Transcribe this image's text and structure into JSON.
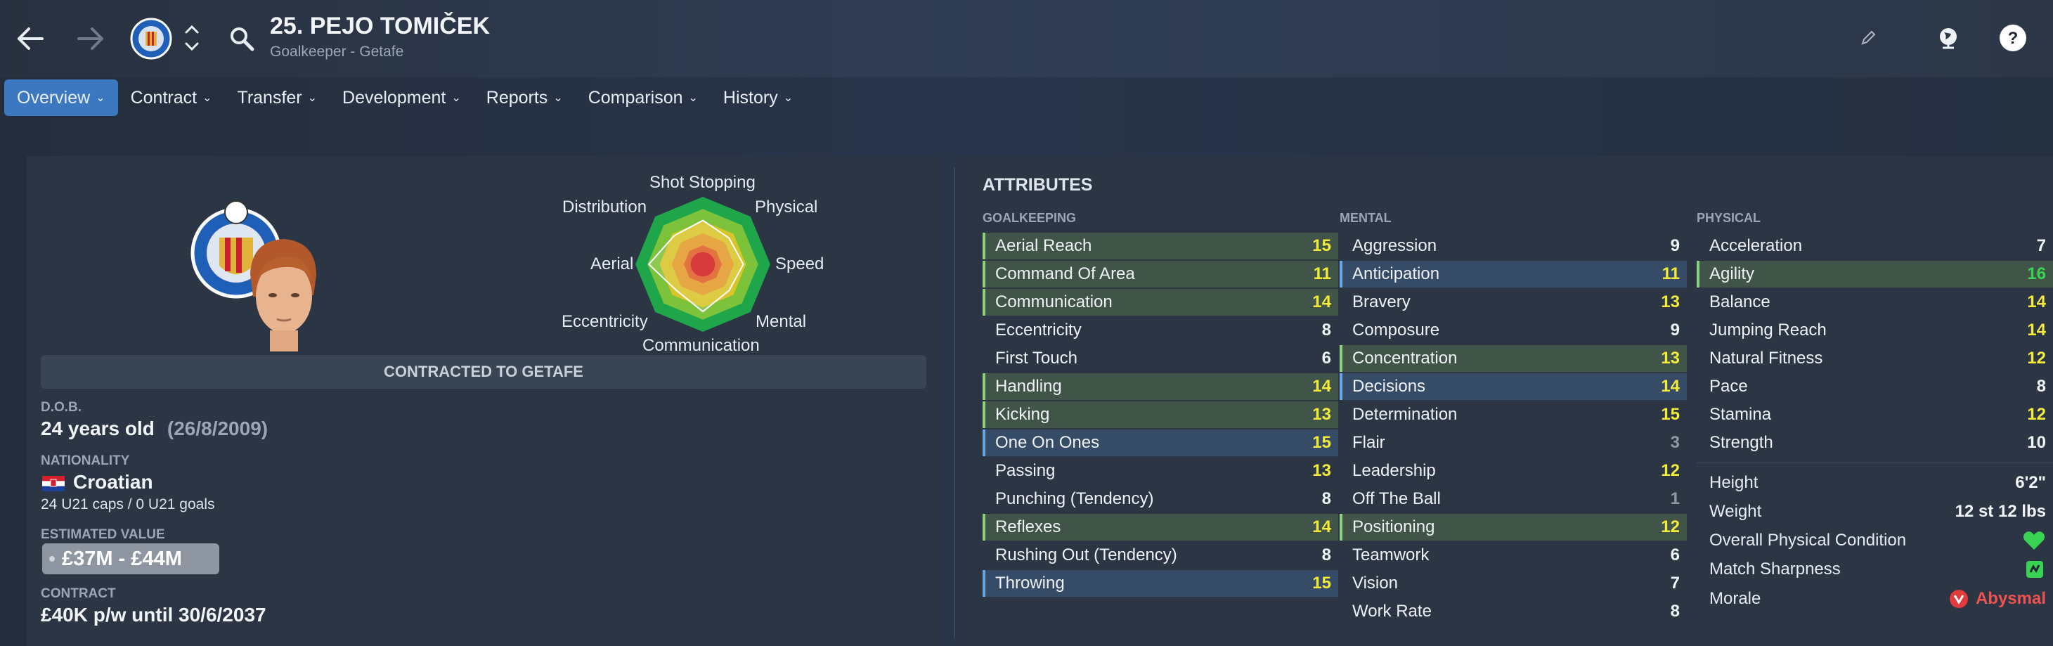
{
  "header": {
    "player_name": "25. PEJO TOMIČEK",
    "subtitle": "Goalkeeper - Getafe"
  },
  "tabs": [
    {
      "label": "Overview",
      "active": true
    },
    {
      "label": "Contract"
    },
    {
      "label": "Transfer"
    },
    {
      "label": "Development"
    },
    {
      "label": "Reports"
    },
    {
      "label": "Comparison"
    },
    {
      "label": "History"
    }
  ],
  "radar": {
    "labels": [
      "Shot Stopping",
      "Physical",
      "Speed",
      "Mental",
      "Communication",
      "Eccentricity",
      "Aerial",
      "Distribution"
    ],
    "values": [
      0.65,
      0.55,
      0.6,
      0.55,
      0.7,
      0.55,
      0.8,
      0.6
    ]
  },
  "profile": {
    "contracted_to": "CONTRACTED TO GETAFE",
    "dob_label": "D.O.B.",
    "age": "24 years old",
    "dob": "(26/8/2009)",
    "nationality_label": "NATIONALITY",
    "nationality": "Croatian",
    "caps": "24 U21 caps / 0 U21 goals",
    "value_label": "ESTIMATED VALUE",
    "value": "£37M - £44M",
    "contract_label": "CONTRACT",
    "contract": "£40K p/w until 30/6/2037"
  },
  "attributes": {
    "title": "ATTRIBUTES",
    "goalkeeping": {
      "heading": "GOALKEEPING",
      "rows": [
        {
          "name": "Aerial Reach",
          "value": "15",
          "hl": "green",
          "color": "#f3ea3b"
        },
        {
          "name": "Command Of Area",
          "value": "11",
          "hl": "green",
          "color": "#f3ea3b"
        },
        {
          "name": "Communication",
          "value": "14",
          "hl": "green",
          "color": "#f3ea3b"
        },
        {
          "name": "Eccentricity",
          "value": "8",
          "hl": "plain",
          "color": "#f2f5f8"
        },
        {
          "name": "First Touch",
          "value": "6",
          "hl": "plain",
          "color": "#f2f5f8"
        },
        {
          "name": "Handling",
          "value": "14",
          "hl": "green",
          "color": "#f3ea3b"
        },
        {
          "name": "Kicking",
          "value": "13",
          "hl": "green",
          "color": "#f3ea3b"
        },
        {
          "name": "One On Ones",
          "value": "15",
          "hl": "blue",
          "color": "#f3ea3b"
        },
        {
          "name": "Passing",
          "value": "13",
          "hl": "plain",
          "color": "#f3ea3b"
        },
        {
          "name": "Punching (Tendency)",
          "value": "8",
          "hl": "plain",
          "color": "#f2f5f8"
        },
        {
          "name": "Reflexes",
          "value": "14",
          "hl": "green",
          "color": "#f3ea3b"
        },
        {
          "name": "Rushing Out (Tendency)",
          "value": "8",
          "hl": "plain",
          "color": "#f2f5f8"
        },
        {
          "name": "Throwing",
          "value": "15",
          "hl": "blue",
          "color": "#f3ea3b"
        }
      ]
    },
    "mental": {
      "heading": "MENTAL",
      "rows": [
        {
          "name": "Aggression",
          "value": "9",
          "hl": "plain",
          "color": "#f2f5f8"
        },
        {
          "name": "Anticipation",
          "value": "11",
          "hl": "blue",
          "color": "#f3ea3b"
        },
        {
          "name": "Bravery",
          "value": "13",
          "hl": "plain",
          "color": "#f3ea3b"
        },
        {
          "name": "Composure",
          "value": "9",
          "hl": "plain",
          "color": "#f2f5f8"
        },
        {
          "name": "Concentration",
          "value": "13",
          "hl": "green",
          "color": "#f3ea3b"
        },
        {
          "name": "Decisions",
          "value": "14",
          "hl": "blue",
          "color": "#f3ea3b"
        },
        {
          "name": "Determination",
          "value": "15",
          "hl": "plain",
          "color": "#f3ea3b"
        },
        {
          "name": "Flair",
          "value": "3",
          "hl": "plain",
          "color": "#8f99a5"
        },
        {
          "name": "Leadership",
          "value": "12",
          "hl": "plain",
          "color": "#f3ea3b"
        },
        {
          "name": "Off The Ball",
          "value": "1",
          "hl": "plain",
          "color": "#8f99a5"
        },
        {
          "name": "Positioning",
          "value": "12",
          "hl": "green",
          "color": "#f3ea3b"
        },
        {
          "name": "Teamwork",
          "value": "6",
          "hl": "plain",
          "color": "#f2f5f8"
        },
        {
          "name": "Vision",
          "value": "7",
          "hl": "plain",
          "color": "#f2f5f8"
        },
        {
          "name": "Work Rate",
          "value": "8",
          "hl": "plain",
          "color": "#f2f5f8"
        }
      ]
    },
    "physical": {
      "heading": "PHYSICAL",
      "rows": [
        {
          "name": "Acceleration",
          "value": "7",
          "hl": "plain",
          "color": "#f2f5f8"
        },
        {
          "name": "Agility",
          "value": "16",
          "hl": "green",
          "color": "#39d353"
        },
        {
          "name": "Balance",
          "value": "14",
          "hl": "plain",
          "color": "#f3ea3b"
        },
        {
          "name": "Jumping Reach",
          "value": "14",
          "hl": "plain",
          "color": "#f3ea3b"
        },
        {
          "name": "Natural Fitness",
          "value": "12",
          "hl": "plain",
          "color": "#f3ea3b"
        },
        {
          "name": "Pace",
          "value": "8",
          "hl": "plain",
          "color": "#f2f5f8"
        },
        {
          "name": "Stamina",
          "value": "12",
          "hl": "plain",
          "color": "#f3ea3b"
        },
        {
          "name": "Strength",
          "value": "10",
          "hl": "plain",
          "color": "#f2f5f8"
        }
      ]
    }
  },
  "physical_meta": {
    "height_label": "Height",
    "height": "6'2\"",
    "weight_label": "Weight",
    "weight": "12 st 12 lbs",
    "condition_label": "Overall Physical Condition",
    "sharpness_label": "Match Sharpness",
    "morale_label": "Morale",
    "morale": "Abysmal"
  }
}
